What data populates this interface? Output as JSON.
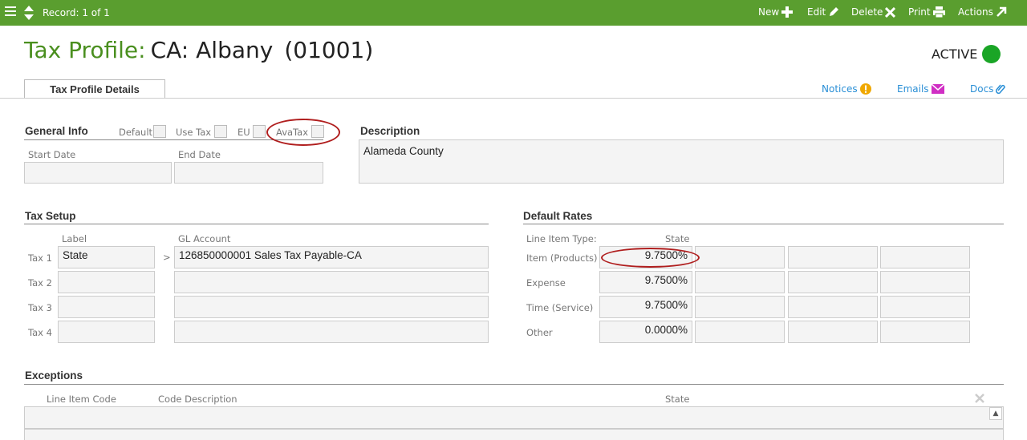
{
  "toolbar": {
    "record": "Record: 1 of 1",
    "new": "New",
    "edit": "Edit",
    "delete": "Delete",
    "print": "Print",
    "actions": "Actions"
  },
  "header": {
    "title_label": "Tax Profile:",
    "title_name": "CA: Albany",
    "title_code": "(01001)",
    "status": "ACTIVE",
    "status_color": "#1aa526"
  },
  "tabs": {
    "active": "Tax Profile Details",
    "notices": "Notices",
    "emails": "Emails",
    "docs": "Docs"
  },
  "general_info": {
    "heading": "General Info",
    "default_label": "Default",
    "use_tax_label": "Use Tax",
    "eu_label": "EU",
    "avatax_label": "AvaTax",
    "start_date_label": "Start Date",
    "end_date_label": "End Date",
    "start_date": "",
    "end_date": ""
  },
  "description": {
    "heading": "Description",
    "value": "Alameda County"
  },
  "tax_setup": {
    "heading": "Tax Setup",
    "label_header": "Label",
    "gl_header": "GL Account",
    "arrow": ">",
    "rows": [
      {
        "name": "Tax 1",
        "label": "State",
        "gl": "126850000001 Sales Tax Payable-CA"
      },
      {
        "name": "Tax 2",
        "label": "",
        "gl": ""
      },
      {
        "name": "Tax 3",
        "label": "",
        "gl": ""
      },
      {
        "name": "Tax 4",
        "label": "",
        "gl": ""
      }
    ]
  },
  "default_rates": {
    "heading": "Default Rates",
    "type_header": "Line Item Type:",
    "state_header": "State",
    "rows": [
      {
        "type": "Item (Products)",
        "state": "9.7500%"
      },
      {
        "type": "Expense",
        "state": "9.7500%"
      },
      {
        "type": "Time (Service)",
        "state": "9.7500%"
      },
      {
        "type": "Other",
        "state": "0.0000%"
      }
    ]
  },
  "exceptions": {
    "heading": "Exceptions",
    "col_code": "Line Item Code",
    "col_desc": "Code Description",
    "col_state": "State"
  },
  "colors": {
    "toolbar": "#5a9e2f",
    "accent_green": "#4a8f1f",
    "link": "#2a8fd6",
    "highlight_oval": "#b01e1e"
  }
}
